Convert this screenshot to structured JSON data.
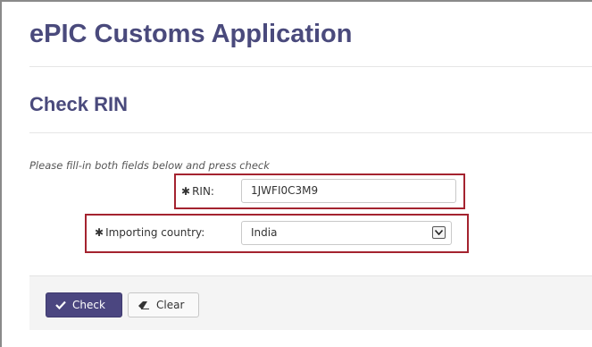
{
  "app": {
    "title": "ePIC Customs Application"
  },
  "section": {
    "title": "Check RIN"
  },
  "form": {
    "instructions": "Please fill-in both fields below and press check",
    "required_marker": "✱",
    "rin": {
      "label": "RIN:",
      "value": "1JWFI0C3M9"
    },
    "importing_country": {
      "label": "Importing country:",
      "value": "India"
    }
  },
  "actions": {
    "check_label": "Check",
    "clear_label": "Clear"
  },
  "colors": {
    "title": "#4a4a7c",
    "primary_button": "#4b4680",
    "highlight_border": "#a4232f"
  },
  "icons": {
    "check": "checkmark-icon",
    "clear": "eraser-icon",
    "dropdown": "chevron-down-icon"
  }
}
